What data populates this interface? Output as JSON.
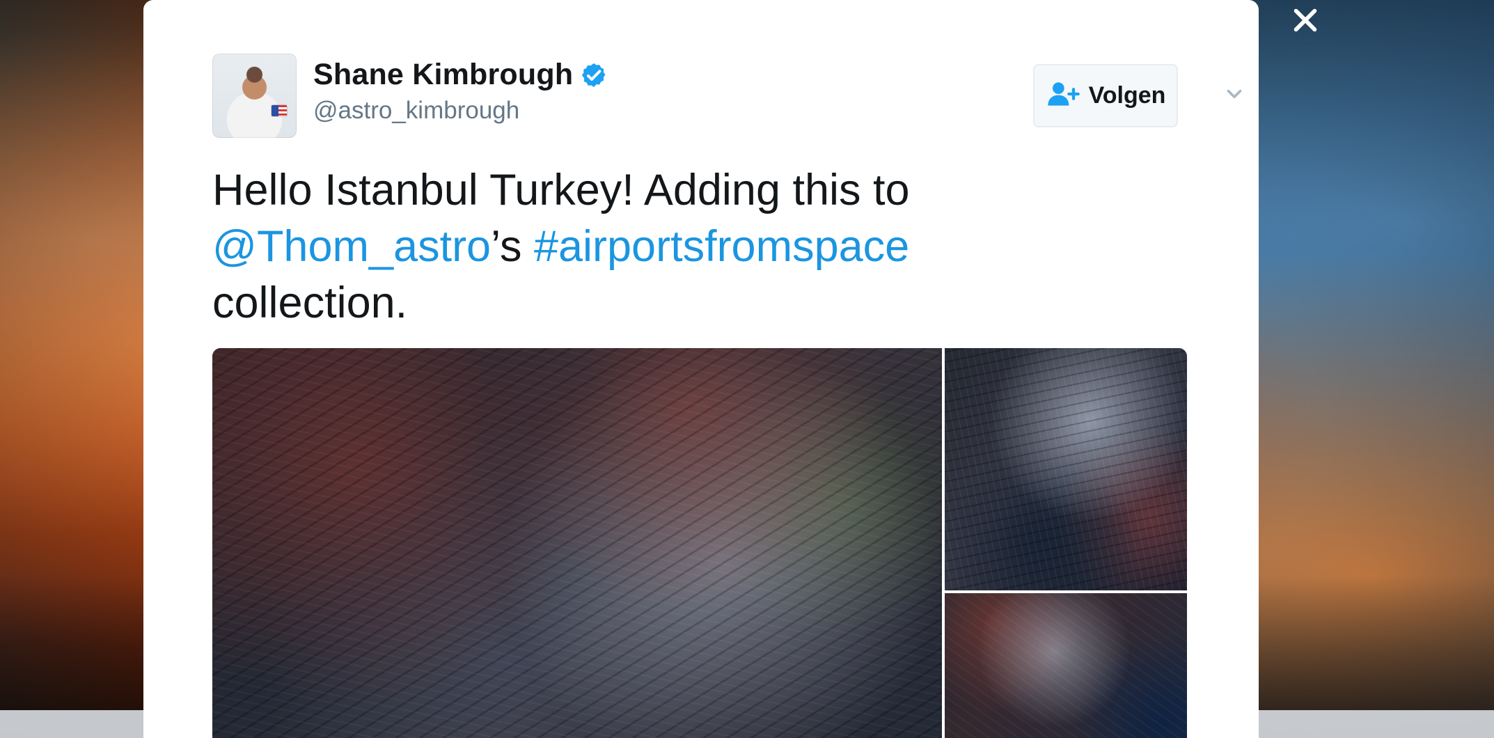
{
  "modal": {
    "author": {
      "display_name": "Shane Kimbrough",
      "handle": "@astro_kimbrough",
      "verified_icon": "verified-badge-icon"
    },
    "actions": {
      "follow_label": "Volgen",
      "follow_icon": "add-user-icon",
      "more_icon": "chevron-down-icon"
    },
    "tweet": {
      "text_before": "Hello Istanbul Turkey!  Adding this to",
      "mention": "@Thom_astro",
      "possessive": "’s ",
      "hashtag": "#airportsfromspace",
      "text_after": "collection."
    },
    "media": {
      "images": [
        {
          "semantic_name": "satellite-image-main"
        },
        {
          "semantic_name": "satellite-image-top-right"
        },
        {
          "semantic_name": "satellite-image-bottom-right"
        }
      ]
    }
  },
  "overlay": {
    "close_icon": "close-icon"
  },
  "colors": {
    "link": "#1b95e0",
    "text": "#14171a",
    "muted": "#657786",
    "verified": "#1da1f2"
  }
}
